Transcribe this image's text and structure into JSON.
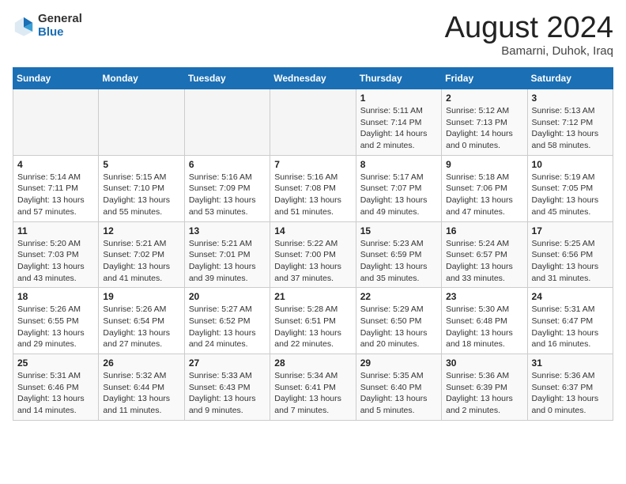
{
  "logo": {
    "general": "General",
    "blue": "Blue"
  },
  "title": {
    "month_year": "August 2024",
    "location": "Bamarni, Duhok, Iraq"
  },
  "weekdays": [
    "Sunday",
    "Monday",
    "Tuesday",
    "Wednesday",
    "Thursday",
    "Friday",
    "Saturday"
  ],
  "weeks": [
    [
      {
        "day": "",
        "info": ""
      },
      {
        "day": "",
        "info": ""
      },
      {
        "day": "",
        "info": ""
      },
      {
        "day": "",
        "info": ""
      },
      {
        "day": "1",
        "info": "Sunrise: 5:11 AM\nSunset: 7:14 PM\nDaylight: 14 hours\nand 2 minutes."
      },
      {
        "day": "2",
        "info": "Sunrise: 5:12 AM\nSunset: 7:13 PM\nDaylight: 14 hours\nand 0 minutes."
      },
      {
        "day": "3",
        "info": "Sunrise: 5:13 AM\nSunset: 7:12 PM\nDaylight: 13 hours\nand 58 minutes."
      }
    ],
    [
      {
        "day": "4",
        "info": "Sunrise: 5:14 AM\nSunset: 7:11 PM\nDaylight: 13 hours\nand 57 minutes."
      },
      {
        "day": "5",
        "info": "Sunrise: 5:15 AM\nSunset: 7:10 PM\nDaylight: 13 hours\nand 55 minutes."
      },
      {
        "day": "6",
        "info": "Sunrise: 5:16 AM\nSunset: 7:09 PM\nDaylight: 13 hours\nand 53 minutes."
      },
      {
        "day": "7",
        "info": "Sunrise: 5:16 AM\nSunset: 7:08 PM\nDaylight: 13 hours\nand 51 minutes."
      },
      {
        "day": "8",
        "info": "Sunrise: 5:17 AM\nSunset: 7:07 PM\nDaylight: 13 hours\nand 49 minutes."
      },
      {
        "day": "9",
        "info": "Sunrise: 5:18 AM\nSunset: 7:06 PM\nDaylight: 13 hours\nand 47 minutes."
      },
      {
        "day": "10",
        "info": "Sunrise: 5:19 AM\nSunset: 7:05 PM\nDaylight: 13 hours\nand 45 minutes."
      }
    ],
    [
      {
        "day": "11",
        "info": "Sunrise: 5:20 AM\nSunset: 7:03 PM\nDaylight: 13 hours\nand 43 minutes."
      },
      {
        "day": "12",
        "info": "Sunrise: 5:21 AM\nSunset: 7:02 PM\nDaylight: 13 hours\nand 41 minutes."
      },
      {
        "day": "13",
        "info": "Sunrise: 5:21 AM\nSunset: 7:01 PM\nDaylight: 13 hours\nand 39 minutes."
      },
      {
        "day": "14",
        "info": "Sunrise: 5:22 AM\nSunset: 7:00 PM\nDaylight: 13 hours\nand 37 minutes."
      },
      {
        "day": "15",
        "info": "Sunrise: 5:23 AM\nSunset: 6:59 PM\nDaylight: 13 hours\nand 35 minutes."
      },
      {
        "day": "16",
        "info": "Sunrise: 5:24 AM\nSunset: 6:57 PM\nDaylight: 13 hours\nand 33 minutes."
      },
      {
        "day": "17",
        "info": "Sunrise: 5:25 AM\nSunset: 6:56 PM\nDaylight: 13 hours\nand 31 minutes."
      }
    ],
    [
      {
        "day": "18",
        "info": "Sunrise: 5:26 AM\nSunset: 6:55 PM\nDaylight: 13 hours\nand 29 minutes."
      },
      {
        "day": "19",
        "info": "Sunrise: 5:26 AM\nSunset: 6:54 PM\nDaylight: 13 hours\nand 27 minutes."
      },
      {
        "day": "20",
        "info": "Sunrise: 5:27 AM\nSunset: 6:52 PM\nDaylight: 13 hours\nand 24 minutes."
      },
      {
        "day": "21",
        "info": "Sunrise: 5:28 AM\nSunset: 6:51 PM\nDaylight: 13 hours\nand 22 minutes."
      },
      {
        "day": "22",
        "info": "Sunrise: 5:29 AM\nSunset: 6:50 PM\nDaylight: 13 hours\nand 20 minutes."
      },
      {
        "day": "23",
        "info": "Sunrise: 5:30 AM\nSunset: 6:48 PM\nDaylight: 13 hours\nand 18 minutes."
      },
      {
        "day": "24",
        "info": "Sunrise: 5:31 AM\nSunset: 6:47 PM\nDaylight: 13 hours\nand 16 minutes."
      }
    ],
    [
      {
        "day": "25",
        "info": "Sunrise: 5:31 AM\nSunset: 6:46 PM\nDaylight: 13 hours\nand 14 minutes."
      },
      {
        "day": "26",
        "info": "Sunrise: 5:32 AM\nSunset: 6:44 PM\nDaylight: 13 hours\nand 11 minutes."
      },
      {
        "day": "27",
        "info": "Sunrise: 5:33 AM\nSunset: 6:43 PM\nDaylight: 13 hours\nand 9 minutes."
      },
      {
        "day": "28",
        "info": "Sunrise: 5:34 AM\nSunset: 6:41 PM\nDaylight: 13 hours\nand 7 minutes."
      },
      {
        "day": "29",
        "info": "Sunrise: 5:35 AM\nSunset: 6:40 PM\nDaylight: 13 hours\nand 5 minutes."
      },
      {
        "day": "30",
        "info": "Sunrise: 5:36 AM\nSunset: 6:39 PM\nDaylight: 13 hours\nand 2 minutes."
      },
      {
        "day": "31",
        "info": "Sunrise: 5:36 AM\nSunset: 6:37 PM\nDaylight: 13 hours\nand 0 minutes."
      }
    ]
  ]
}
